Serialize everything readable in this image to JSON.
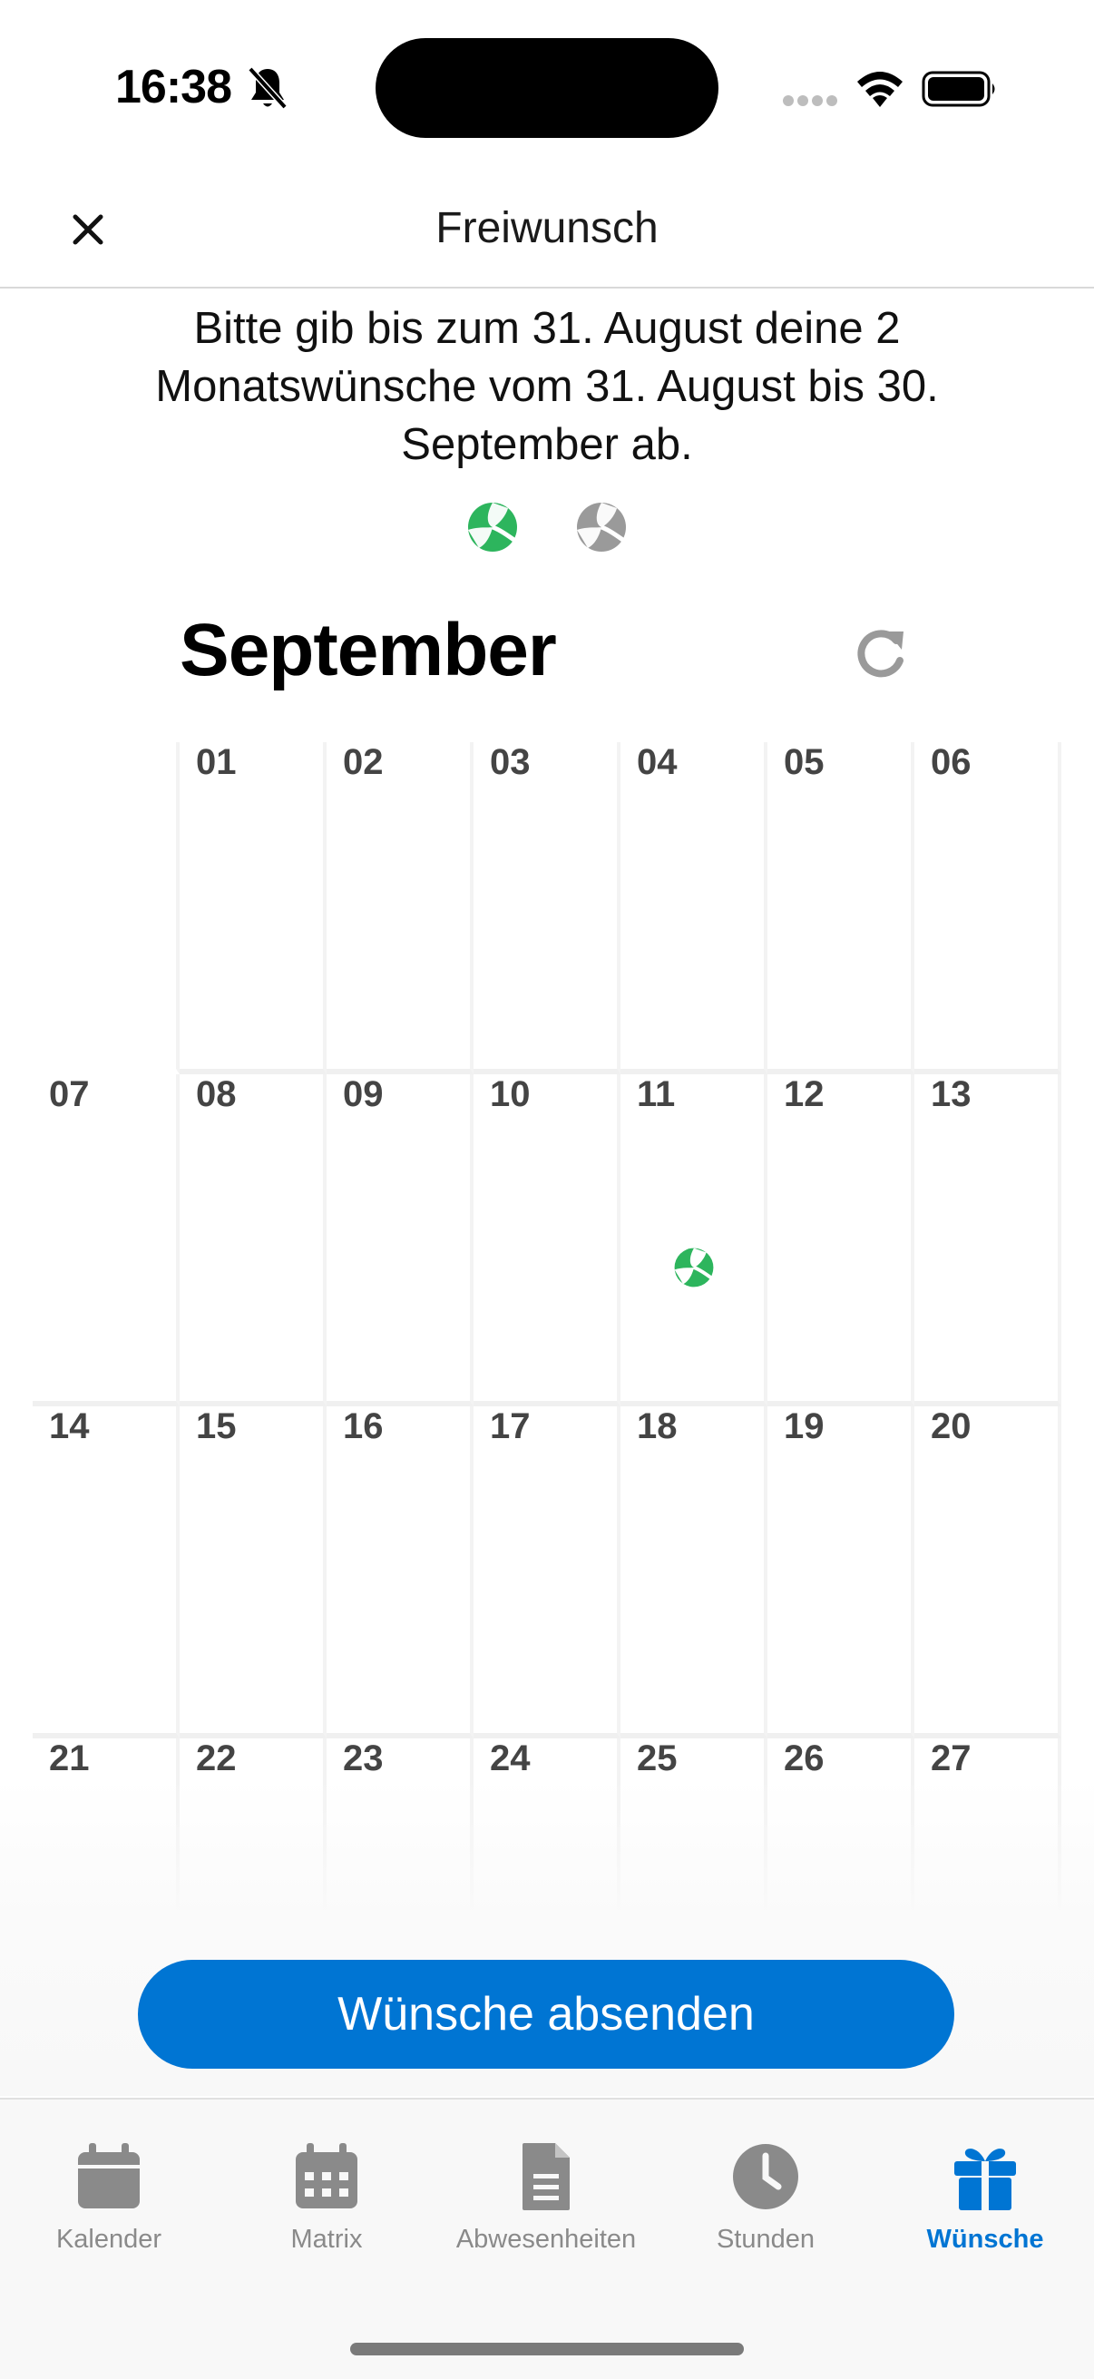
{
  "status_bar": {
    "time": "16:38"
  },
  "header": {
    "title": "Freiwunsch",
    "close_icon": "close-icon"
  },
  "info": {
    "text": "Bitte gib bis zum 31. August deine 2 Monatswünsche vom 31. August bis 30. September ab.",
    "wish_icons": [
      {
        "name": "beach-ball-icon",
        "state": "used",
        "color": "#2db55d"
      },
      {
        "name": "beach-ball-icon",
        "state": "available",
        "color": "#9a9a9a"
      }
    ]
  },
  "calendar": {
    "month": "September",
    "reset_icon": "refresh-icon",
    "weeks": [
      [
        "",
        "01",
        "02",
        "03",
        "04",
        "05",
        "06"
      ],
      [
        "07",
        "08",
        "09",
        "10",
        "11",
        "12",
        "13"
      ],
      [
        "14",
        "15",
        "16",
        "17",
        "18",
        "19",
        "20"
      ],
      [
        "21",
        "22",
        "23",
        "24",
        "25",
        "26",
        "27"
      ]
    ],
    "wish_day": "11"
  },
  "actions": {
    "submit_label": "Wünsche absenden"
  },
  "tabs": [
    {
      "label": "Kalender",
      "icon": "calendar-icon",
      "active": false
    },
    {
      "label": "Matrix",
      "icon": "matrix-calendar-icon",
      "active": false
    },
    {
      "label": "Abwesenheiten",
      "icon": "document-icon",
      "active": false
    },
    {
      "label": "Stunden",
      "icon": "clock-icon",
      "active": false
    },
    {
      "label": "Wünsche",
      "icon": "gift-icon",
      "active": true
    }
  ],
  "colors": {
    "accent": "#0075d3",
    "wish_green": "#2db55d",
    "inactive": "#8a8a8a"
  }
}
